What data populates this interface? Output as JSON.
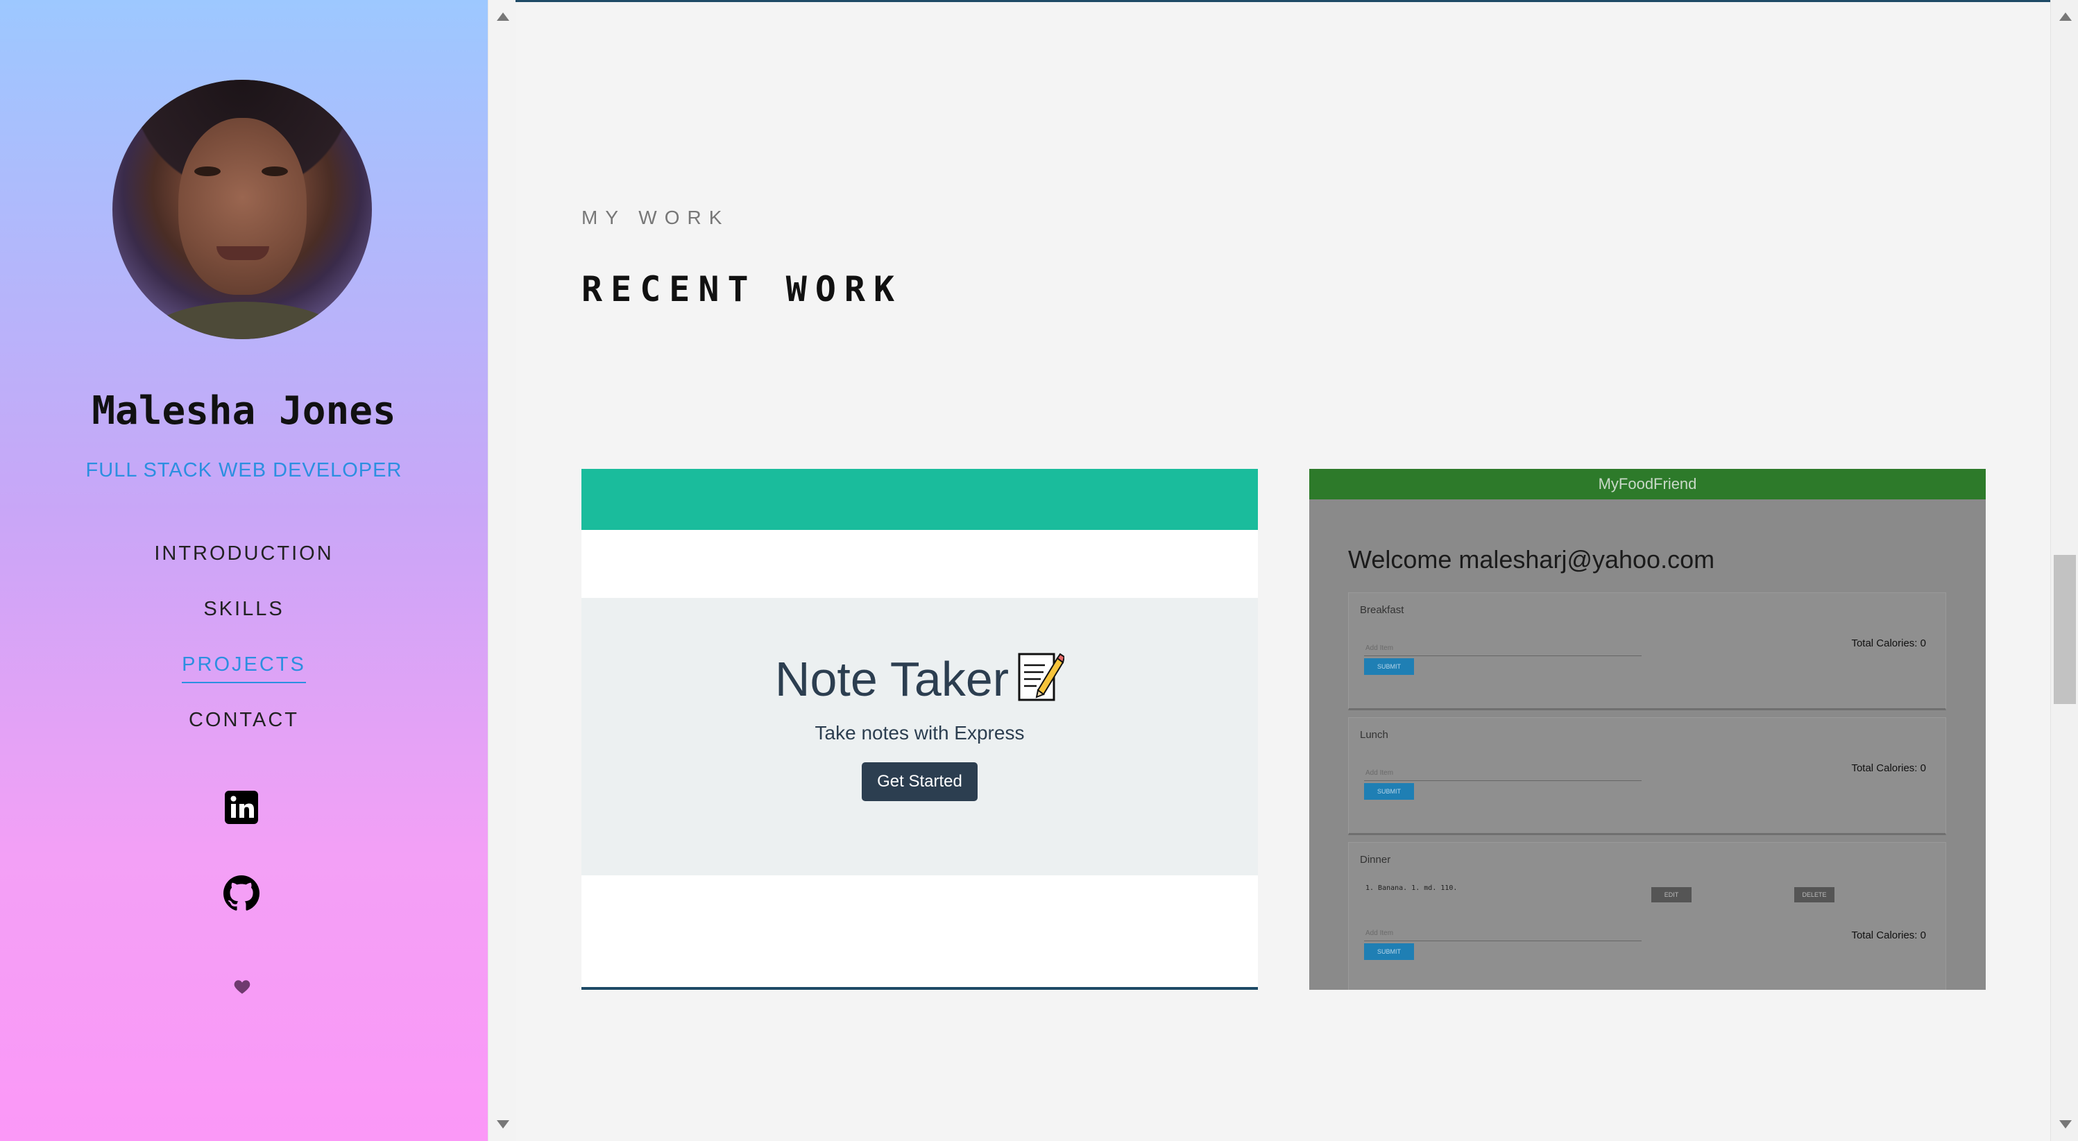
{
  "profile": {
    "name": "Malesha Jones",
    "role": "FULL STACK WEB DEVELOPER"
  },
  "nav": {
    "items": [
      {
        "label": "INTRODUCTION",
        "active": false
      },
      {
        "label": "SKILLS",
        "active": false
      },
      {
        "label": "PROJECTS",
        "active": true
      },
      {
        "label": "CONTACT",
        "active": false
      }
    ]
  },
  "social": {
    "icons": [
      "linkedin-icon",
      "github-icon",
      "heart-icon"
    ]
  },
  "section": {
    "eyebrow": "MY WORK",
    "title": "RECENT WORK"
  },
  "projects": [
    {
      "heading": "Note Taker",
      "subtitle": "Take notes with Express",
      "button": "Get Started",
      "colors": {
        "topbar": "#1abc9c",
        "button": "#2c3e50"
      }
    },
    {
      "app_title": "MyFoodFriend",
      "welcome": "Welcome malesharj@yahoo.com",
      "meals": [
        {
          "name": "Breakfast",
          "placeholder": "Add Item",
          "submit": "SUBMIT",
          "calories": "Total Calories: 0"
        },
        {
          "name": "Lunch",
          "placeholder": "Add Item",
          "submit": "SUBMIT",
          "calories": "Total Calories: 0"
        },
        {
          "name": "Dinner",
          "entry": "1. Banana. 1. md. 110.",
          "edit": "EDIT",
          "delete": "DELETE",
          "placeholder": "Add Item",
          "submit": "SUBMIT",
          "calories": "Total Calories: 0"
        }
      ]
    }
  ]
}
